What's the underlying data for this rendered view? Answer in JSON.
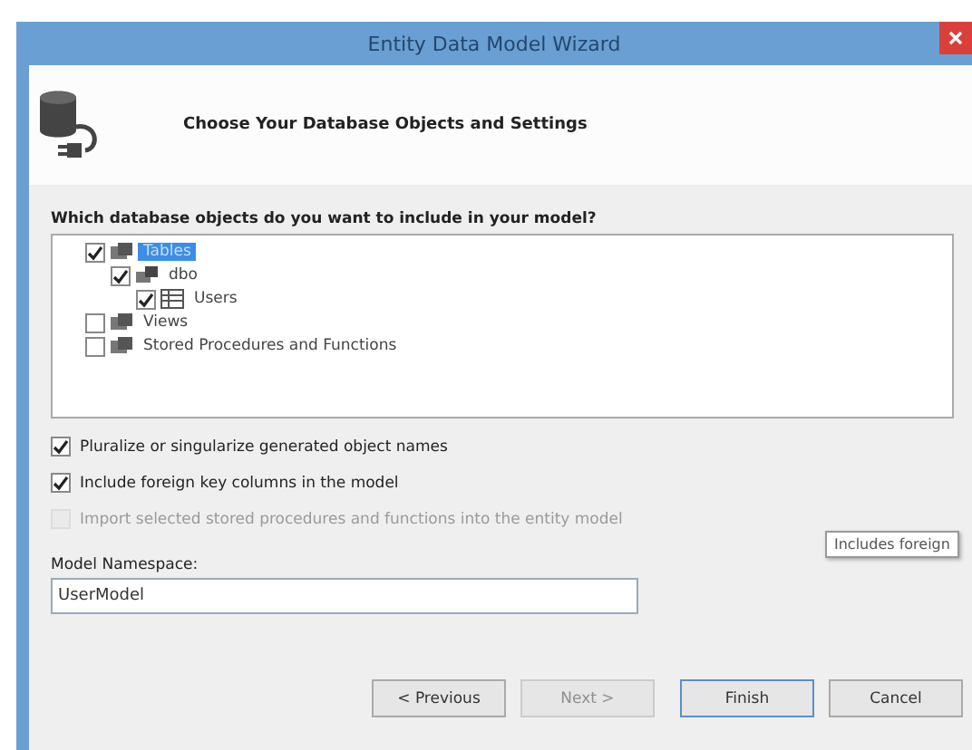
{
  "window": {
    "title": "Entity Data Model Wizard"
  },
  "header": {
    "title": "Choose Your Database Objects and Settings"
  },
  "tree": {
    "label": "Which database objects do you want to include in your model?",
    "items": [
      {
        "label": "Tables",
        "checked": true,
        "selected": true,
        "kind": "folder",
        "children": [
          {
            "label": "dbo",
            "checked": true,
            "selected": false,
            "kind": "schema",
            "children": [
              {
                "label": "Users",
                "checked": true,
                "selected": false,
                "kind": "table"
              }
            ]
          }
        ]
      },
      {
        "label": "Views",
        "checked": false,
        "selected": false,
        "kind": "folder"
      },
      {
        "label": "Stored Procedures and Functions",
        "checked": false,
        "selected": false,
        "kind": "folder"
      }
    ]
  },
  "options": [
    {
      "label": "Pluralize or singularize generated object names",
      "checked": true,
      "disabled": false
    },
    {
      "label": "Include foreign key columns in the model",
      "checked": true,
      "disabled": false
    },
    {
      "label": "Import selected stored procedures and functions into the entity model",
      "checked": false,
      "disabled": true
    }
  ],
  "tooltip": "Includes foreign",
  "namespace": {
    "label": "Model Namespace:",
    "value": "UserModel"
  },
  "buttons": [
    {
      "label": "< Previous",
      "disabled": false,
      "default": false
    },
    {
      "label": "Next >",
      "disabled": true,
      "default": false
    },
    {
      "label": "Finish",
      "disabled": false,
      "default": true
    },
    {
      "label": "Cancel",
      "disabled": false,
      "default": false
    }
  ]
}
